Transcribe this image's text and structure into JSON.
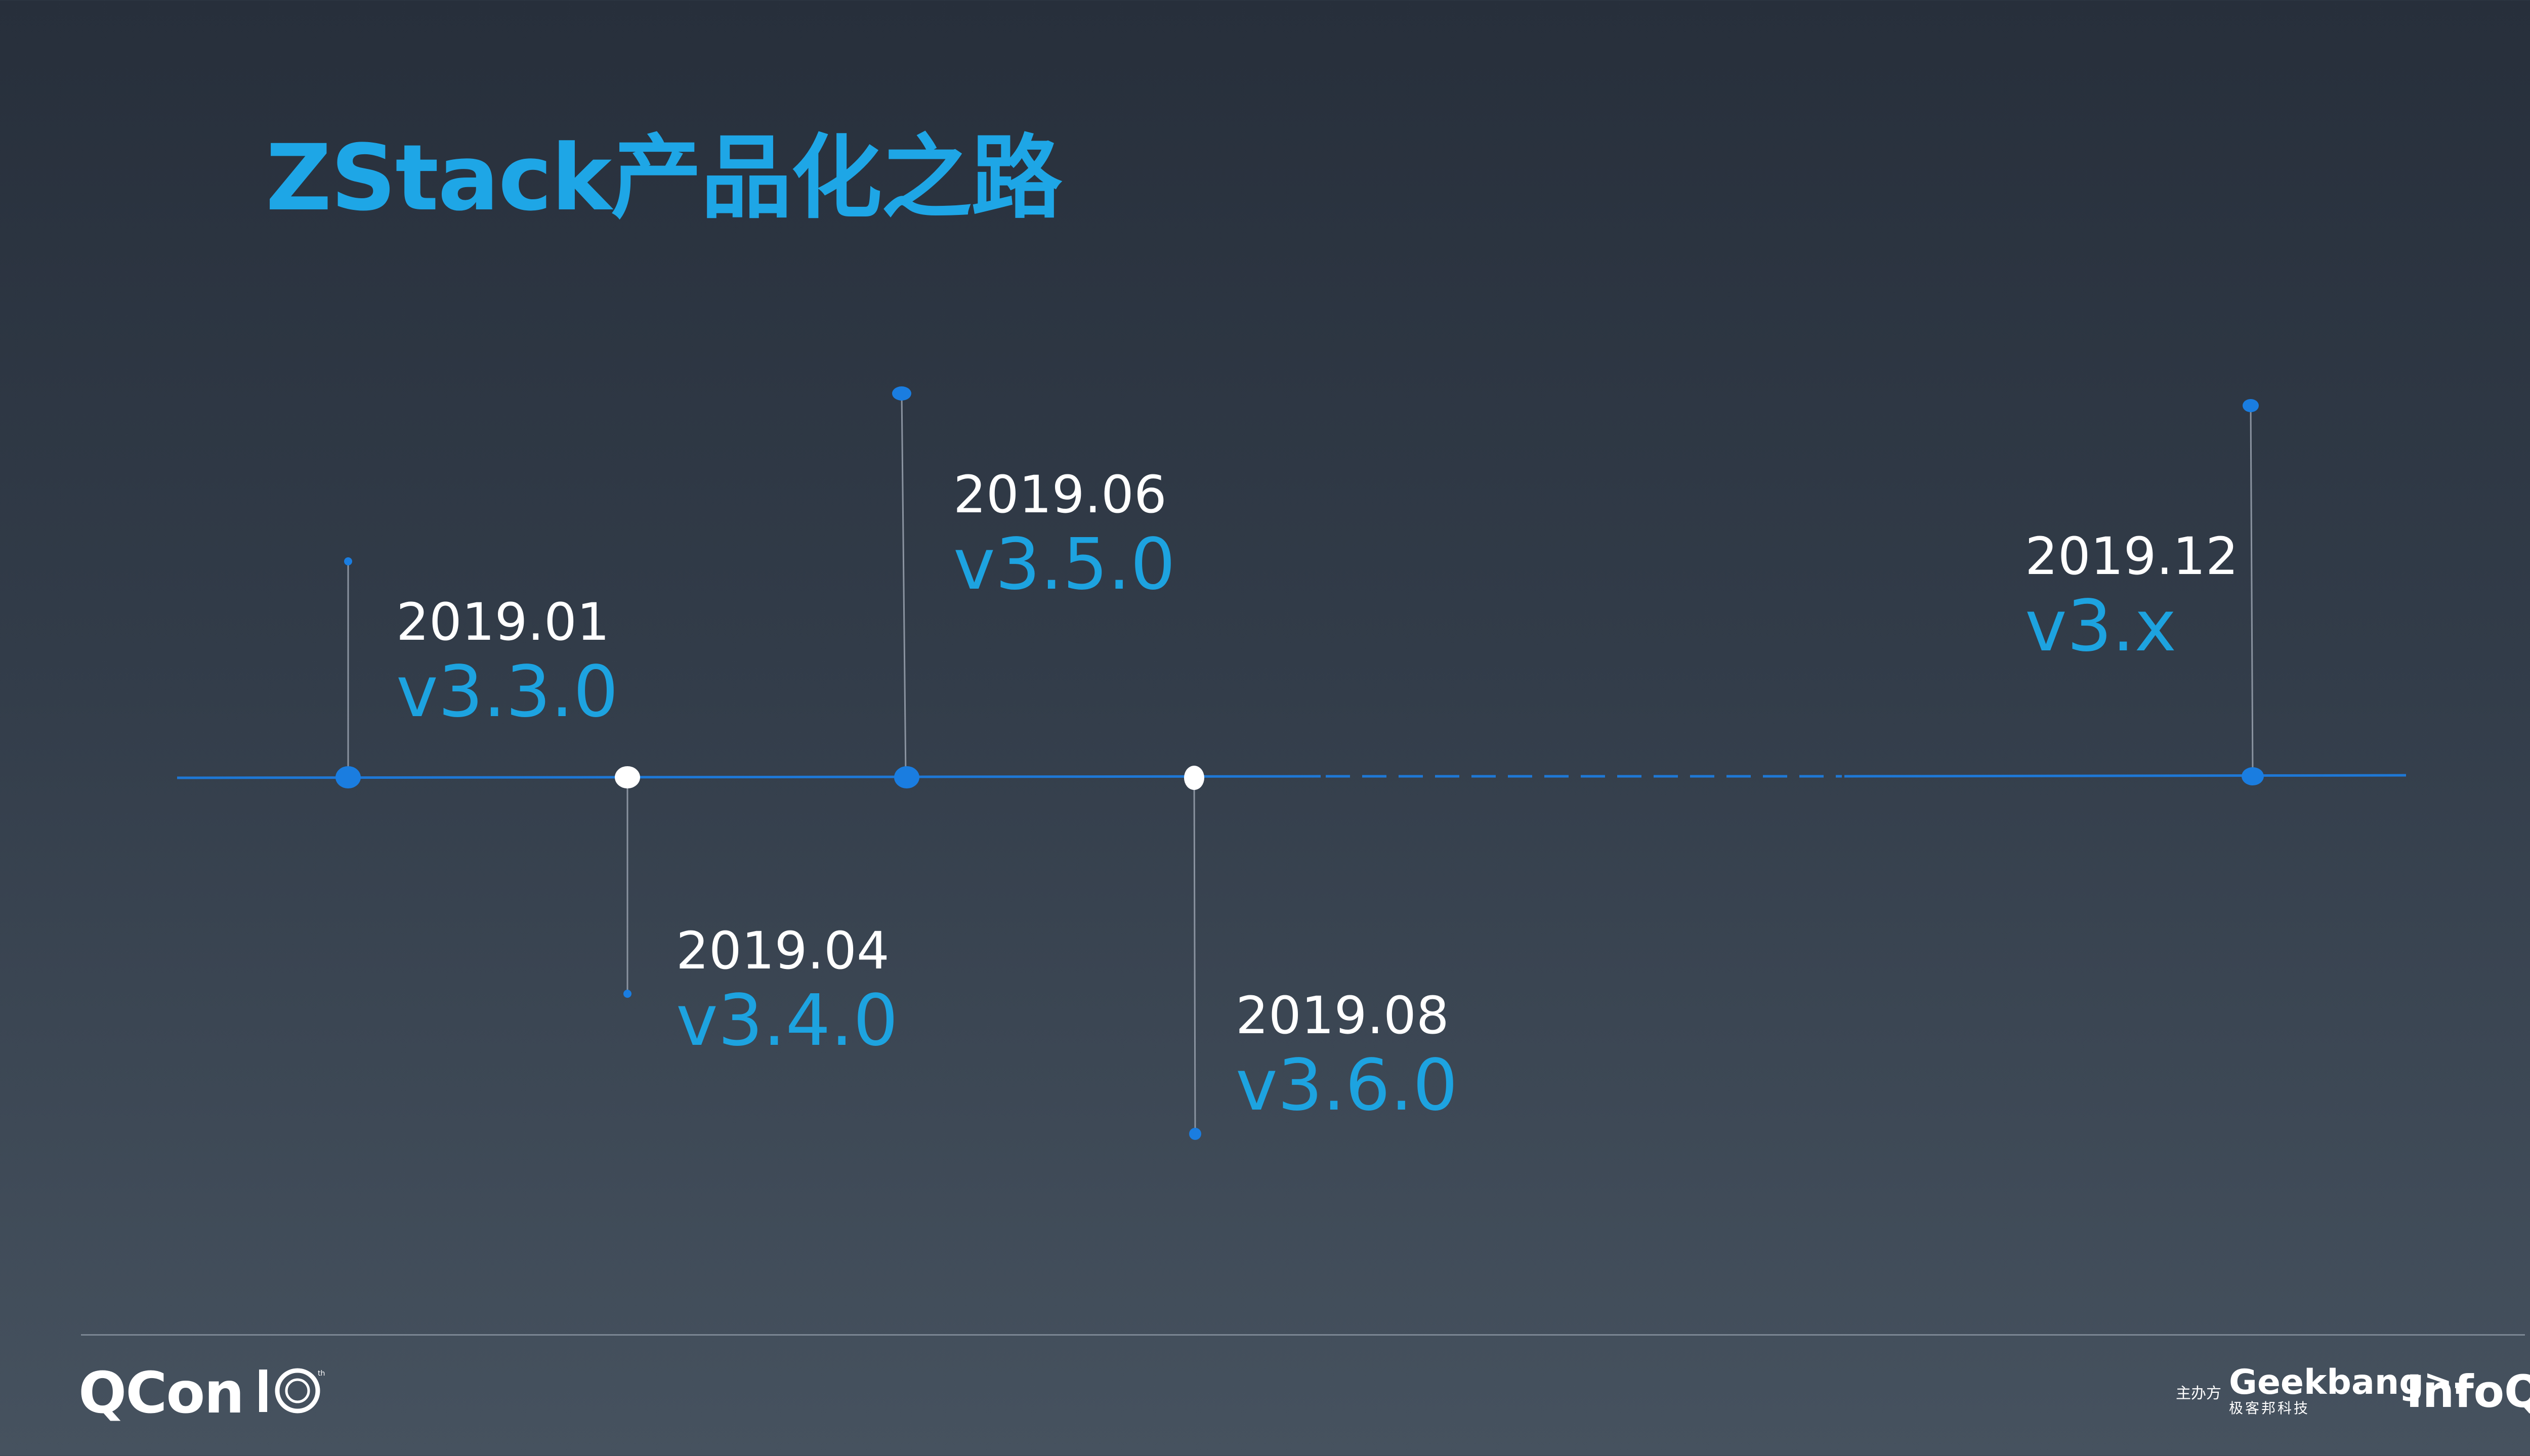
{
  "title": "ZStack产品化之路",
  "milestones": [
    {
      "date": "2019.01",
      "version": "v3.3.0"
    },
    {
      "date": "2019.04",
      "version": "v3.4.0"
    },
    {
      "date": "2019.06",
      "version": "v3.5.0"
    },
    {
      "date": "2019.08",
      "version": "v3.6.0"
    },
    {
      "date": "2019.12",
      "version": "v3.x"
    }
  ],
  "footer": {
    "brand": "QCon",
    "edition_icon": "ten-years-icon",
    "organizer_label": "主办方",
    "geekbang_name": "Geekbang>.",
    "geekbang_sub": "极客邦科技",
    "infoq": "InfoQ"
  },
  "colors": {
    "accent": "#1ea6e6",
    "timeline": "#1e78d6",
    "dot_blue": "#1a7de0",
    "dot_white": "#ffffff"
  }
}
